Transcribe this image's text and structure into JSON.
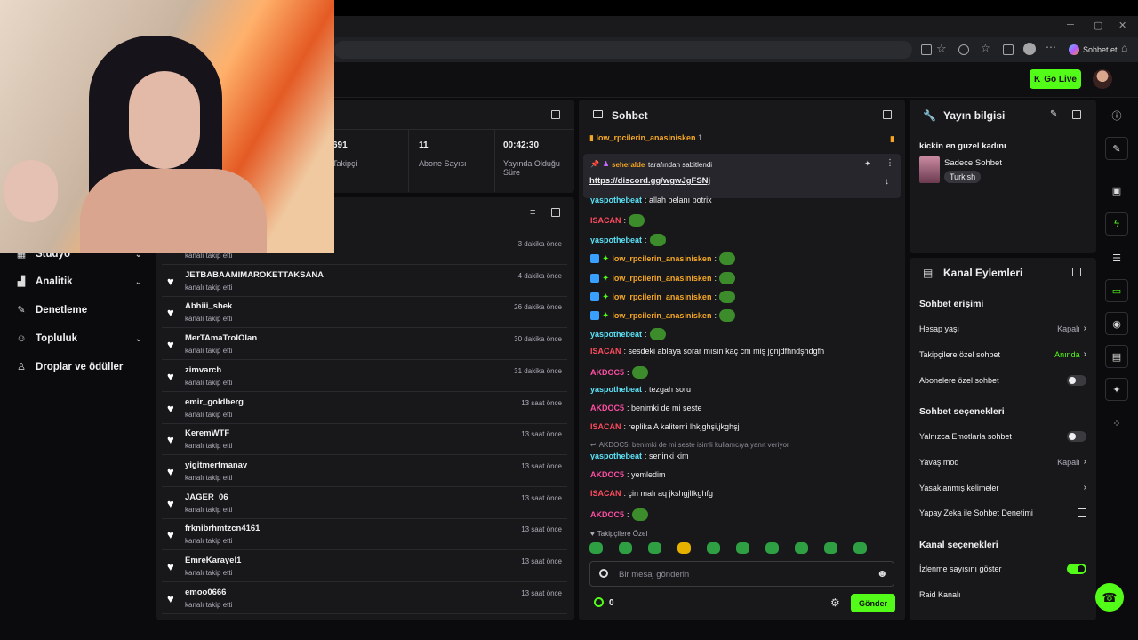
{
  "browser": {
    "copilot_label": "Sohbet et"
  },
  "header": {
    "go_live": "Go Live"
  },
  "sidebar": {
    "items": [
      {
        "label": "Stüdyo",
        "icon": "studio-icon",
        "has_chevron": true
      },
      {
        "label": "Analitik",
        "icon": "analytics-icon",
        "has_chevron": true
      },
      {
        "label": "Denetleme",
        "icon": "wrench-icon",
        "has_chevron": false
      },
      {
        "label": "Topluluk",
        "icon": "community-icon",
        "has_chevron": true
      },
      {
        "label": "Droplar ve ödüller",
        "icon": "gift-icon",
        "has_chevron": false
      }
    ]
  },
  "stats": {
    "followers_value": "691",
    "followers_label": "Takipçi",
    "subs_value": "11",
    "subs_label": "Abone Sayısı",
    "uptime_value": "00:42:30",
    "uptime_label": "Yayında Olduğu Süre"
  },
  "followers": [
    {
      "name": "",
      "sub": "kanalı takip etti",
      "time": "3 dakika önce"
    },
    {
      "name": "JETBABAAMIMAROKETTAKSANA",
      "sub": "kanalı takip etti",
      "time": "4 dakika önce"
    },
    {
      "name": "Abhiii_shek",
      "sub": "kanalı takip etti",
      "time": "26 dakika önce"
    },
    {
      "name": "MerTAmaTrolOlan",
      "sub": "kanalı takip etti",
      "time": "30 dakika önce"
    },
    {
      "name": "zimvarch",
      "sub": "kanalı takip etti",
      "time": "31 dakika önce"
    },
    {
      "name": "emir_goldberg",
      "sub": "kanalı takip etti",
      "time": "13 saat önce"
    },
    {
      "name": "KeremWTF",
      "sub": "kanalı takip etti",
      "time": "13 saat önce"
    },
    {
      "name": "yigitmertmanav",
      "sub": "kanalı takip etti",
      "time": "13 saat önce"
    },
    {
      "name": "JAGER_06",
      "sub": "kanalı takip etti",
      "time": "13 saat önce"
    },
    {
      "name": "frknibrhmtzcn4161",
      "sub": "kanalı takip etti",
      "time": "13 saat önce"
    },
    {
      "name": "EmreKarayel1",
      "sub": "kanalı takip etti",
      "time": "13 saat önce"
    },
    {
      "name": "emoo0666",
      "sub": "kanalı takip etti",
      "time": "13 saat önce"
    }
  ],
  "chat": {
    "title": "Sohbet",
    "top_gifter": "low_rpcilerin_anasinisken",
    "top_gifter_count": "1",
    "pinned_by_user": "seheralde",
    "pinned_by_text": "tarafından sabitlendi",
    "pinned_link": "https://discord.gg/wgwJgFSNj",
    "messages": [
      {
        "user": "yaspothebeat",
        "color": "#5ce1f5",
        "text": ": allah belanı botrix",
        "badges": false,
        "emote": false
      },
      {
        "user": "ISACAN",
        "color": "#ff4b5c",
        "text": ":",
        "badges": false,
        "emote": true
      },
      {
        "user": "yaspothebeat",
        "color": "#5ce1f5",
        "text": ":",
        "badges": false,
        "emote": true
      },
      {
        "user": "low_rpcilerin_anasinisken",
        "color": "#f5a623",
        "text": ":",
        "badges": true,
        "emote": true
      },
      {
        "user": "low_rpcilerin_anasinisken",
        "color": "#f5a623",
        "text": ":",
        "badges": true,
        "emote": true
      },
      {
        "user": "low_rpcilerin_anasinisken",
        "color": "#f5a623",
        "text": ":",
        "badges": true,
        "emote": true
      },
      {
        "user": "low_rpcilerin_anasinisken",
        "color": "#f5a623",
        "text": ":",
        "badges": true,
        "emote": true
      },
      {
        "user": "yaspothebeat",
        "color": "#5ce1f5",
        "text": ":",
        "badges": false,
        "emote": true
      },
      {
        "user": "ISACAN",
        "color": "#ff4b5c",
        "text": ": sesdeki ablaya sorar mısın kaç cm miş jgnjdfhndşhdgfh",
        "badges": false,
        "emote": false
      },
      {
        "user": "AKDOC5",
        "color": "#ff4fa3",
        "text": ":",
        "badges": false,
        "emote": true
      },
      {
        "user": "yaspothebeat",
        "color": "#5ce1f5",
        "text": ": tezgah soru",
        "badges": false,
        "emote": false
      },
      {
        "user": "AKDOC5",
        "color": "#ff4fa3",
        "text": ": benimki de mi seste",
        "badges": false,
        "emote": false
      },
      {
        "user": "ISACAN",
        "color": "#ff4b5c",
        "text": ": replika A kalitemi lhkjghşi,jkghşj",
        "badges": false,
        "emote": false
      },
      {
        "user": "yaspothebeat",
        "color": "#5ce1f5",
        "text": ": seninki kim",
        "badges": false,
        "emote": false
      },
      {
        "user": "AKDOC5",
        "color": "#ff4fa3",
        "text": ": yemledim",
        "badges": false,
        "emote": false
      },
      {
        "user": "ISACAN",
        "color": "#ff4b5c",
        "text": ": çin malı aq jkshgjlfkghfg",
        "badges": false,
        "emote": false
      },
      {
        "user": "AKDOC5",
        "color": "#ff4fa3",
        "text": ":",
        "badges": false,
        "emote": true
      }
    ],
    "reply_context": "AKDOC5: benimki de mi seste isimli kullanıcıya yanıt veriyor",
    "follower_only_label": "Takipçilere Özel",
    "input_placeholder": "Bir mesaj gönderin",
    "points": "0",
    "send_label": "Gönder"
  },
  "stream_info": {
    "title": "Yayın bilgisi",
    "stream_title": "kickin en guzel kadını",
    "category": "Sadece Sohbet",
    "tag": "Turkish"
  },
  "channel_actions": {
    "title": "Kanal Eylemleri",
    "chat_access_header": "Sohbet erişimi",
    "account_age_label": "Hesap yaşı",
    "account_age_value": "Kapalı",
    "followers_only_label": "Takipçilere özel sohbet",
    "followers_only_value": "Anında",
    "subs_only_label": "Abonelere özel sohbet",
    "chat_options_header": "Sohbet seçenekleri",
    "emote_only_label": "Yalnızca Emotlarla sohbet",
    "slow_mode_label": "Yavaş mod",
    "slow_mode_value": "Kapalı",
    "banned_words_label": "Yasaklanmış kelimeler",
    "ai_moderation_label": "Yapay Zeka ile Sohbet Denetimi",
    "channel_options_header": "Kanal seçenekleri",
    "show_viewers_label": "İzlenme sayısını göster",
    "raid_label": "Raid Kanalı"
  },
  "colors": {
    "accent": "#53fc18",
    "panel": "#18181b",
    "bg": "#0b0b0d"
  }
}
